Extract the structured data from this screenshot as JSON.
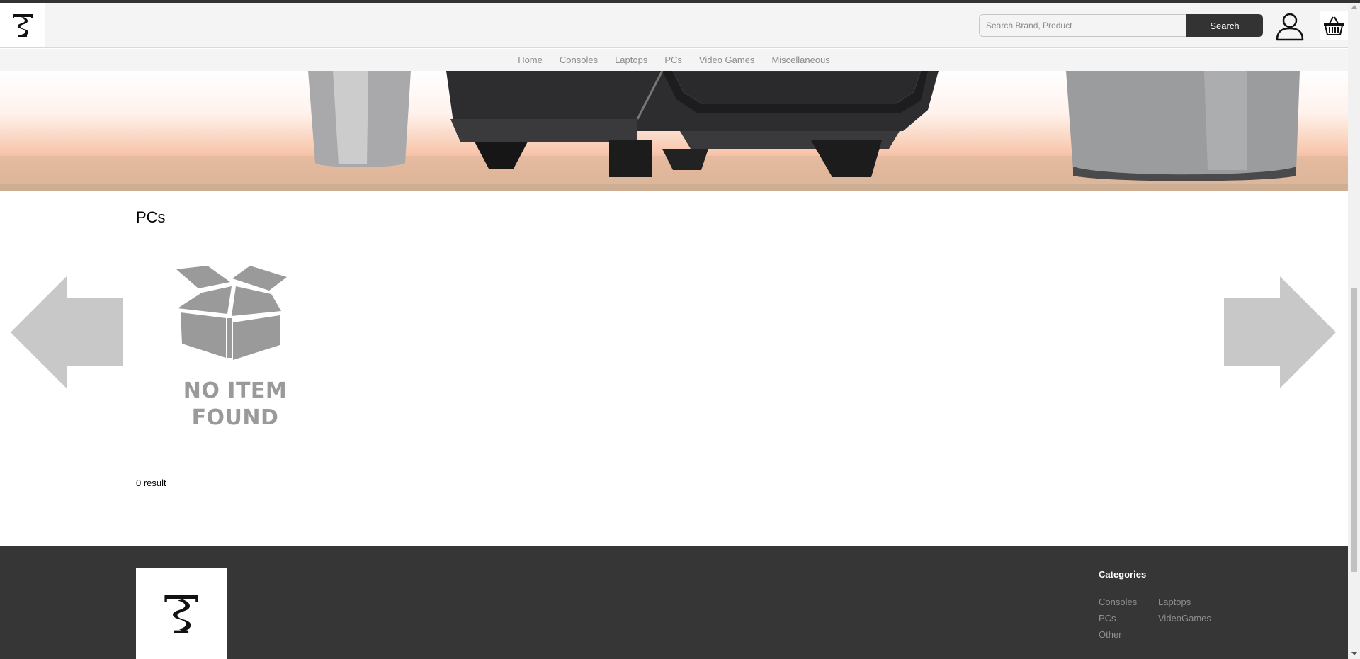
{
  "header": {
    "search_placeholder": "Search Brand, Product",
    "search_button": "Search"
  },
  "nav": {
    "items": [
      "Home",
      "Consoles",
      "Laptops",
      "PCs",
      "Video Games",
      "Miscellaneous"
    ]
  },
  "main": {
    "title": "PCs",
    "empty_state_line1": "NO ITEM",
    "empty_state_line2": "FOUND",
    "result_count": "0 result"
  },
  "footer": {
    "categories_title": "Categories",
    "links": [
      "Consoles",
      "Laptops",
      "PCs",
      "VideoGames",
      "Other"
    ]
  },
  "icons": {
    "logo": "t-logo-icon",
    "user": "user-icon",
    "cart": "basket-icon",
    "prev": "arrow-left-icon",
    "next": "arrow-right-icon",
    "empty": "open-box-icon"
  },
  "colors": {
    "dark": "#333333",
    "footer_bg": "#363636",
    "header_bg": "#f4f4f4",
    "nav_text": "#8c8c8c",
    "arrow": "#c8c8c8",
    "empty_state": "#9a9a9a"
  }
}
